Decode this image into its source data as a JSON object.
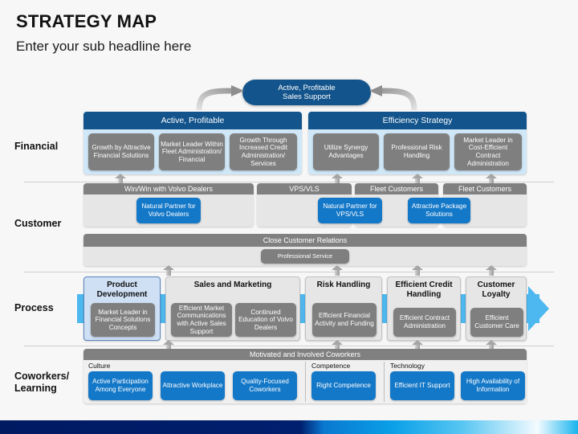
{
  "header": {
    "title": "STRATEGY MAP",
    "subtitle": "Enter your sub headline here"
  },
  "colors": {
    "dark_blue": "#13548C",
    "bright_blue": "#1478C8",
    "cyan": "#4DB8EF",
    "gray_header": "#808080",
    "gray_box": "#7F7F7F",
    "light_panel": "#E6E6E6",
    "sky_panel": "#CFE7F7",
    "highlight_panel": "#CFE0F5",
    "page_bg": "#F7F7F7"
  },
  "top_objective": {
    "label": "Active, Profitable\nSales Support",
    "line1": "Active, Profitable",
    "line2": "Sales Support"
  },
  "rows": [
    {
      "key": "financial",
      "label": "Financial"
    },
    {
      "key": "customer",
      "label": "Customer"
    },
    {
      "key": "process",
      "label": "Process"
    },
    {
      "key": "coworkers",
      "label": "Coworkers/\nLearning",
      "line1": "Coworkers/",
      "line2": "Learning"
    }
  ],
  "financial": {
    "groups": [
      {
        "header": "Active, Profitable",
        "items": [
          "Growth by Attractive Financial Solutions",
          "Market Leader Within Fleet Administration/ Financial",
          "Growth Through Increased Credit Administration/ Services"
        ]
      },
      {
        "header": "Efficiency Strategy",
        "items": [
          "Utilize Synergy Advantages",
          "Professional Risk Handling",
          "Market Leader in Cost-Efficient Contract Administration"
        ]
      }
    ]
  },
  "customer": {
    "groups": [
      {
        "header": "Win/Win with Volvo Dealers",
        "items": [
          "Natural Partner for Volvo Dealers"
        ]
      },
      {
        "header": "VPS/VLS",
        "items": [
          "Natural Partner for VPS/VLS"
        ]
      },
      {
        "header": "Fleet Customers",
        "items": [
          "Attractive Package Solutions"
        ]
      },
      {
        "header": "Fleet Customers",
        "items": []
      }
    ],
    "close_relations": {
      "header": "Close Customer Relations",
      "items": [
        "Professional Service"
      ]
    }
  },
  "process": {
    "boxes": [
      {
        "title": "Product Development",
        "highlight": true,
        "items": [
          "Market Leader in Financial Solutions Concepts"
        ]
      },
      {
        "title": "Sales and Marketing",
        "highlight": false,
        "items": [
          "Efficient Market Communications with Active Sales Support",
          "Continued Education of Volvo Dealers"
        ]
      },
      {
        "title": "Risk Handling",
        "highlight": false,
        "items": [
          "Efficient Financial Activity and Funding"
        ]
      },
      {
        "title": "Efficient Credit Handling",
        "highlight": false,
        "items": [
          "Efficient Contract Administration"
        ]
      },
      {
        "title": "Customer Loyalty",
        "highlight": false,
        "items": [
          "Efficient Customer Care"
        ]
      }
    ]
  },
  "coworkers": {
    "header": "Motivated and Involved Coworkers",
    "sections": [
      {
        "label": "Culture",
        "items": [
          "Active Participation Among Everyone",
          "Attractive Workplace",
          "Quality-Focused Coworkers"
        ]
      },
      {
        "label": "Competence",
        "items": [
          "Right Competence"
        ]
      },
      {
        "label": "Technology",
        "items": [
          "Efficient IT Support",
          "High Availability of Information"
        ]
      }
    ]
  }
}
